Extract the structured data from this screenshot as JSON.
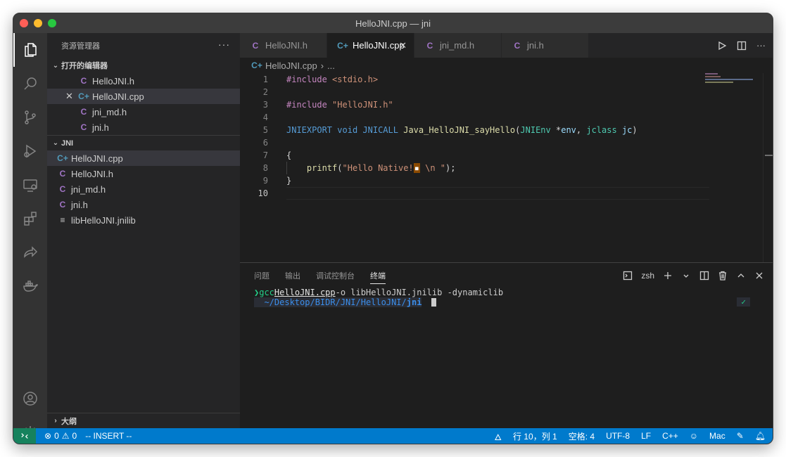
{
  "window": {
    "title": "HelloJNI.cpp — jni"
  },
  "activity_bar": {
    "items": [
      "explorer",
      "search",
      "source-control",
      "run-and-debug",
      "remote-explorer",
      "extensions",
      "live-share",
      "docker",
      "accounts",
      "manage"
    ]
  },
  "sidebar": {
    "title": "资源管理器",
    "more": "···",
    "open_editors": {
      "title": "打开的编辑器",
      "items": [
        {
          "name": "HelloJNI.h",
          "icon": "C"
        },
        {
          "name": "HelloJNI.cpp",
          "icon": "C+",
          "close": "✕"
        },
        {
          "name": "jni_md.h",
          "icon": "C"
        },
        {
          "name": "jni.h",
          "icon": "C"
        }
      ]
    },
    "folder": {
      "title": "JNI",
      "items": [
        {
          "name": "HelloJNI.cpp",
          "icon": "C+"
        },
        {
          "name": "HelloJNI.h",
          "icon": "C"
        },
        {
          "name": "jni_md.h",
          "icon": "C"
        },
        {
          "name": "jni.h",
          "icon": "C"
        },
        {
          "name": "libHelloJNI.jnilib",
          "icon": "≡"
        }
      ]
    },
    "outline": {
      "title": "大纲"
    }
  },
  "tabs": [
    {
      "label": "HelloJNI.h",
      "icon": "C"
    },
    {
      "label": "HelloJNI.cpp",
      "icon": "C+",
      "close": "✕"
    },
    {
      "label": "jni_md.h",
      "icon": "C"
    },
    {
      "label": "jni.h",
      "icon": "C"
    }
  ],
  "breadcrumb": {
    "file": "HelloJNI.cpp",
    "sep": "›",
    "rest": "..."
  },
  "editor": {
    "line_numbers": [
      "1",
      "2",
      "3",
      "4",
      "5",
      "6",
      "7",
      "8",
      "9",
      "10"
    ],
    "lines": [
      "#include <stdio.h>",
      "",
      "#include \"HelloJNI.h\"",
      "",
      "JNIEXPORT void JNICALL Java_HelloJNI_sayHello(JNIEnv *env, jclass jc)",
      "",
      "{",
      "    printf(\"Hello Native!\\u25aa \\n \");",
      "}",
      ""
    ],
    "code": {
      "l1_pp": "#include",
      "l1_str": "<stdio.h>",
      "l3_pp": "#include",
      "l3_str": "\"HelloJNI.h\"",
      "l5_m1": "JNIEXPORT",
      "l5_kw": "void",
      "l5_m2": "JNICALL",
      "l5_fn": "Java_HelloJNI_sayHello",
      "l5_p1": "(",
      "l5_ty1": "JNIEnv",
      "l5_op": " *",
      "l5_v1": "env",
      "l5_c": ", ",
      "l5_ty2": "jclass",
      "l5_v2": "jc",
      "l5_p2": ")",
      "l7": "{",
      "l8_fn": "printf",
      "l8_p1": "(",
      "l8_str1": "\"Hello Native!",
      "l8_bad": "▪",
      "l8_str2": " \\n \"",
      "l8_p2": ");",
      "l9": "}"
    }
  },
  "panel": {
    "tabs": [
      "问题",
      "输出",
      "调试控制台",
      "终端"
    ],
    "active_tab": "终端",
    "shell": "zsh",
    "terminal": {
      "prompt": "❯",
      "cmd1": "gcc",
      "file": "HelloJNI.cpp",
      "args": "-o libHelloJNI.jnilib -dynamiclib",
      "seg_icons": "  ",
      "path": "~/Desktop/BIDR/JNI/HelloJNI/",
      "dir": "jni",
      "check": "✓"
    }
  },
  "status_bar": {
    "errors": "0",
    "warnings": "0",
    "mode": "-- INSERT --",
    "position": "行 10，列 1",
    "spaces": "空格: 4",
    "encoding": "UTF-8",
    "eol": "LF",
    "language": "C++",
    "platform": "Mac"
  },
  "colors": {
    "statusbar": "#007acc",
    "remote": "#16825d",
    "editor_bg": "#1e1e1e",
    "sidebar_bg": "#252526"
  }
}
